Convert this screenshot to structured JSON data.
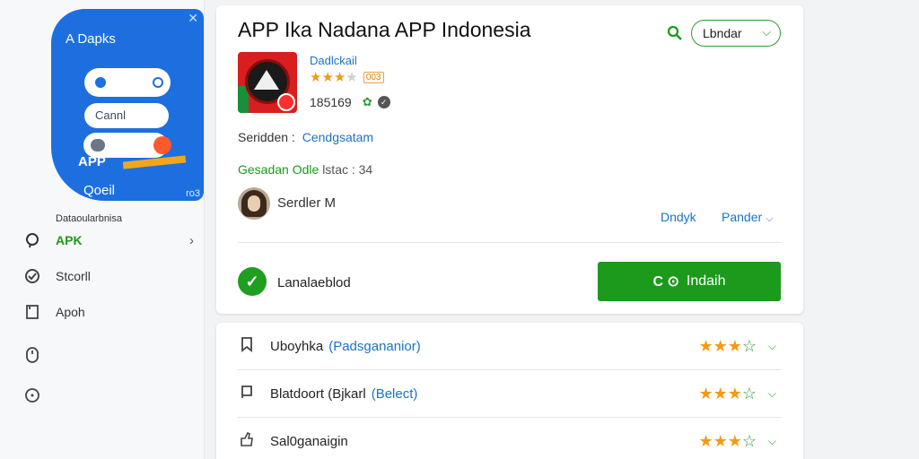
{
  "sidebar": {
    "promo": {
      "brand": "A Dapks",
      "field_label": "Cannl",
      "app_label": "APP",
      "footer_label": "Qoeil",
      "corner_label": "ro3"
    },
    "caption": "Dataoularbnisa",
    "items": [
      {
        "label": "APK",
        "icon": "apk-icon",
        "active": true
      },
      {
        "label": "Stcorll",
        "icon": "shield-icon"
      },
      {
        "label": "Apoh",
        "icon": "document-icon"
      },
      {
        "label": "",
        "icon": "mouse-icon"
      },
      {
        "label": "",
        "icon": "clock-icon"
      }
    ]
  },
  "header": {
    "title": "APP Ika Nadana APP Indonesia",
    "language_button": "Lbndar"
  },
  "app": {
    "developer": "Dadlckail",
    "rating_badge": "003",
    "stars": 3,
    "downloads": "185169",
    "size_label": "Seridden :",
    "size_value": "Cendgsatam",
    "info_label": "Gesadan Odle",
    "info_value": "lstac : 34",
    "author": "Serdler M",
    "link_1": "Dndyk",
    "link_2": "Pander",
    "status": "Lanalaeblod",
    "install_button": "Indaih"
  },
  "list": [
    {
      "title": "Uboyhka",
      "subtitle": "(Padsgananior)",
      "icon": "bookmark-icon",
      "stars": 4
    },
    {
      "title": "Blatdoort (Bjkarl",
      "subtitle": "(Belect)",
      "icon": "flag-icon",
      "stars": 4
    },
    {
      "title": "Sal0ganaigin",
      "subtitle": "",
      "icon": "thumb-icon",
      "stars": 4
    }
  ],
  "colors": {
    "accent_green": "#1c9a1c",
    "link_blue": "#1a73c8",
    "promo_blue": "#1d6fe0",
    "star_orange": "#f29a15"
  }
}
